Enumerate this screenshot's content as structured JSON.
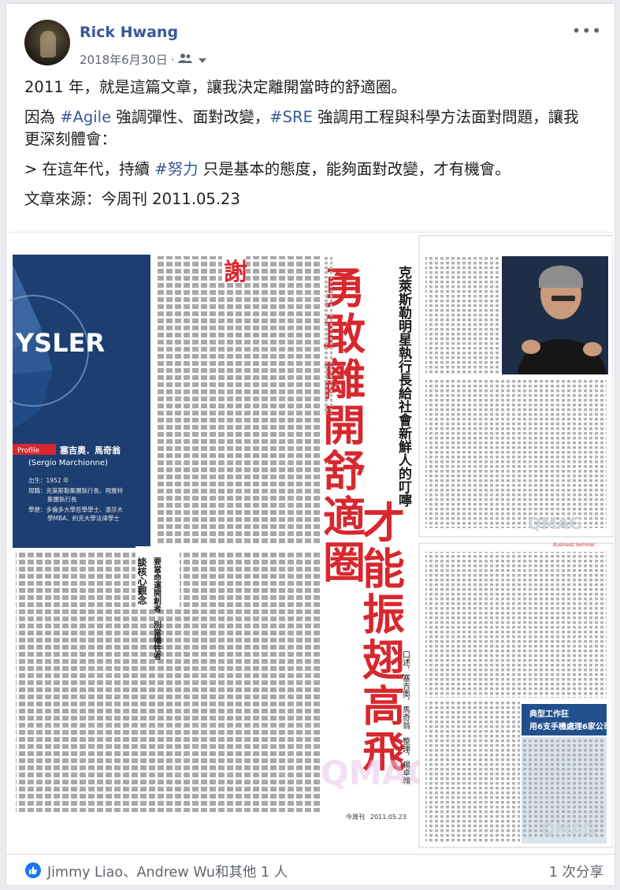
{
  "post": {
    "author": "Rick Hwang",
    "date": "2018年6月30日",
    "date_sep": "·",
    "audience_icon": "friends-icon",
    "more_icon": "more-options-icon",
    "more_glyph": "•••"
  },
  "text": {
    "p1": "2011 年，就是這篇文章，讓我決定離開當時的舒適圈。",
    "p2_a": "因為 ",
    "p2_tag1": "#Agile",
    "p2_b": " 強調彈性、面對改變，",
    "p2_tag2": "#SRE",
    "p2_c": " 強調用工程與科學方法面對問題，讓我更深刻體會：",
    "p3_a": "> 在這年代，持續 ",
    "p3_tag": "#努力",
    "p3_b": " 只是基本的態度，能夠面對改變，才有機會。",
    "p4": "文章來源：今周刊 2011.05.23"
  },
  "article": {
    "headline_1": "勇敢離開舒適圈",
    "headline_2": "才能振翅高飛",
    "chrysler_partial": "YSLER",
    "profile_tag": "Profile",
    "profile_name": "塞吉奧．馬奇翁",
    "profile_name_en": "(Sergio Marchionne)",
    "profile_born": "出生：1952 年",
    "profile_job": "現職：克萊斯勒集團執行長、飛雅特",
    "profile_job2": "集團執行長",
    "profile_edu": "學歷：多倫多大學哲學學士、溫莎大",
    "profile_edu2": "學MBA、約克大學法律學士",
    "byline": "口述．塞吉奧．馬奇翁　整理．楊卓翰",
    "right_headline": "克萊斯勒明星執行長給社會新鮮人的叮嚀",
    "section_title": "談核心觀念",
    "section_sub": "要當命運開創者　別當犧牲者",
    "source_footer": "今周刊",
    "source_date": "2011.05.23",
    "watermark": "QMAG",
    "box_title": "典型工作狂",
    "box_sub": "用6支手機處理6家公司",
    "business_tag": "Business Seminar"
  },
  "reactions": {
    "like_icon": "thumbs-up-icon",
    "likers": "Jimmy Liao、Andrew Wu和其他 1 人",
    "shares": "1 次分享"
  },
  "colors": {
    "link": "#385898",
    "headline_red": "#d7282f",
    "chrysler_blue": "#22508c"
  }
}
